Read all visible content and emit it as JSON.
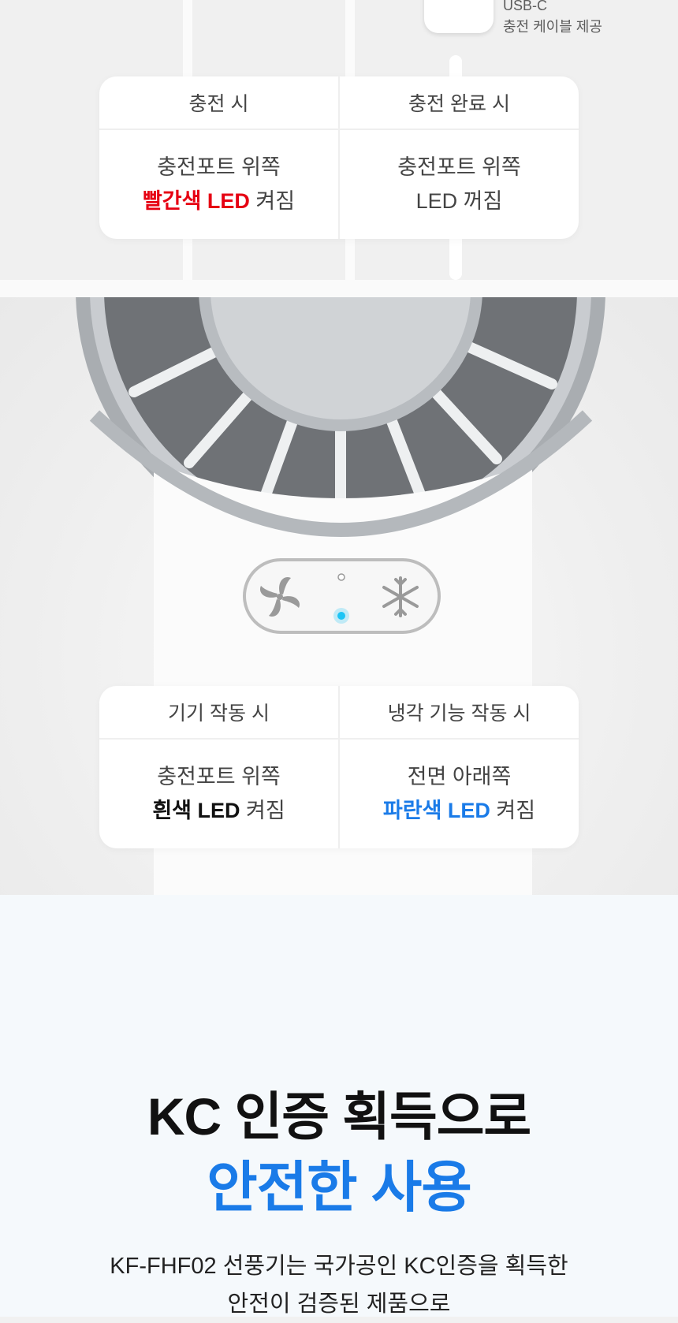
{
  "cable": {
    "label_line1": "USB-C",
    "label_line2": "충전 케이블 제공"
  },
  "charging_table": {
    "left": {
      "header": "충전 시",
      "line1": "충전포트 위쪽",
      "line2_highlight": "빨간색 LED",
      "line2_rest": " 켜짐"
    },
    "right": {
      "header": "충전 완료 시",
      "line1": "충전포트 위쪽",
      "line2": "LED 꺼짐"
    }
  },
  "operation_table": {
    "left": {
      "header": "기기 작동 시",
      "line1": "충전포트 위쪽",
      "line2_highlight": "흰색 LED",
      "line2_rest": " 켜짐"
    },
    "right": {
      "header": "냉각 기능 작동 시",
      "line1": "전면 아래쪽",
      "line2_highlight": "파란색 LED",
      "line2_rest": " 켜짐"
    }
  },
  "kc": {
    "title_line1": "KC 인증 획득으로",
    "title_line2": "안전한 사용",
    "desc_line1": "KF-FHF02 선풍기는 국가공인 KC인증을 획득한",
    "desc_line2": "안전이 검증된 제품으로"
  },
  "colors": {
    "red": "#e60012",
    "blue": "#1a7be8",
    "led_blue": "#1cc4f5"
  },
  "icons": {
    "fan_button": "fan-icon",
    "cool_button": "snowflake-icon"
  }
}
